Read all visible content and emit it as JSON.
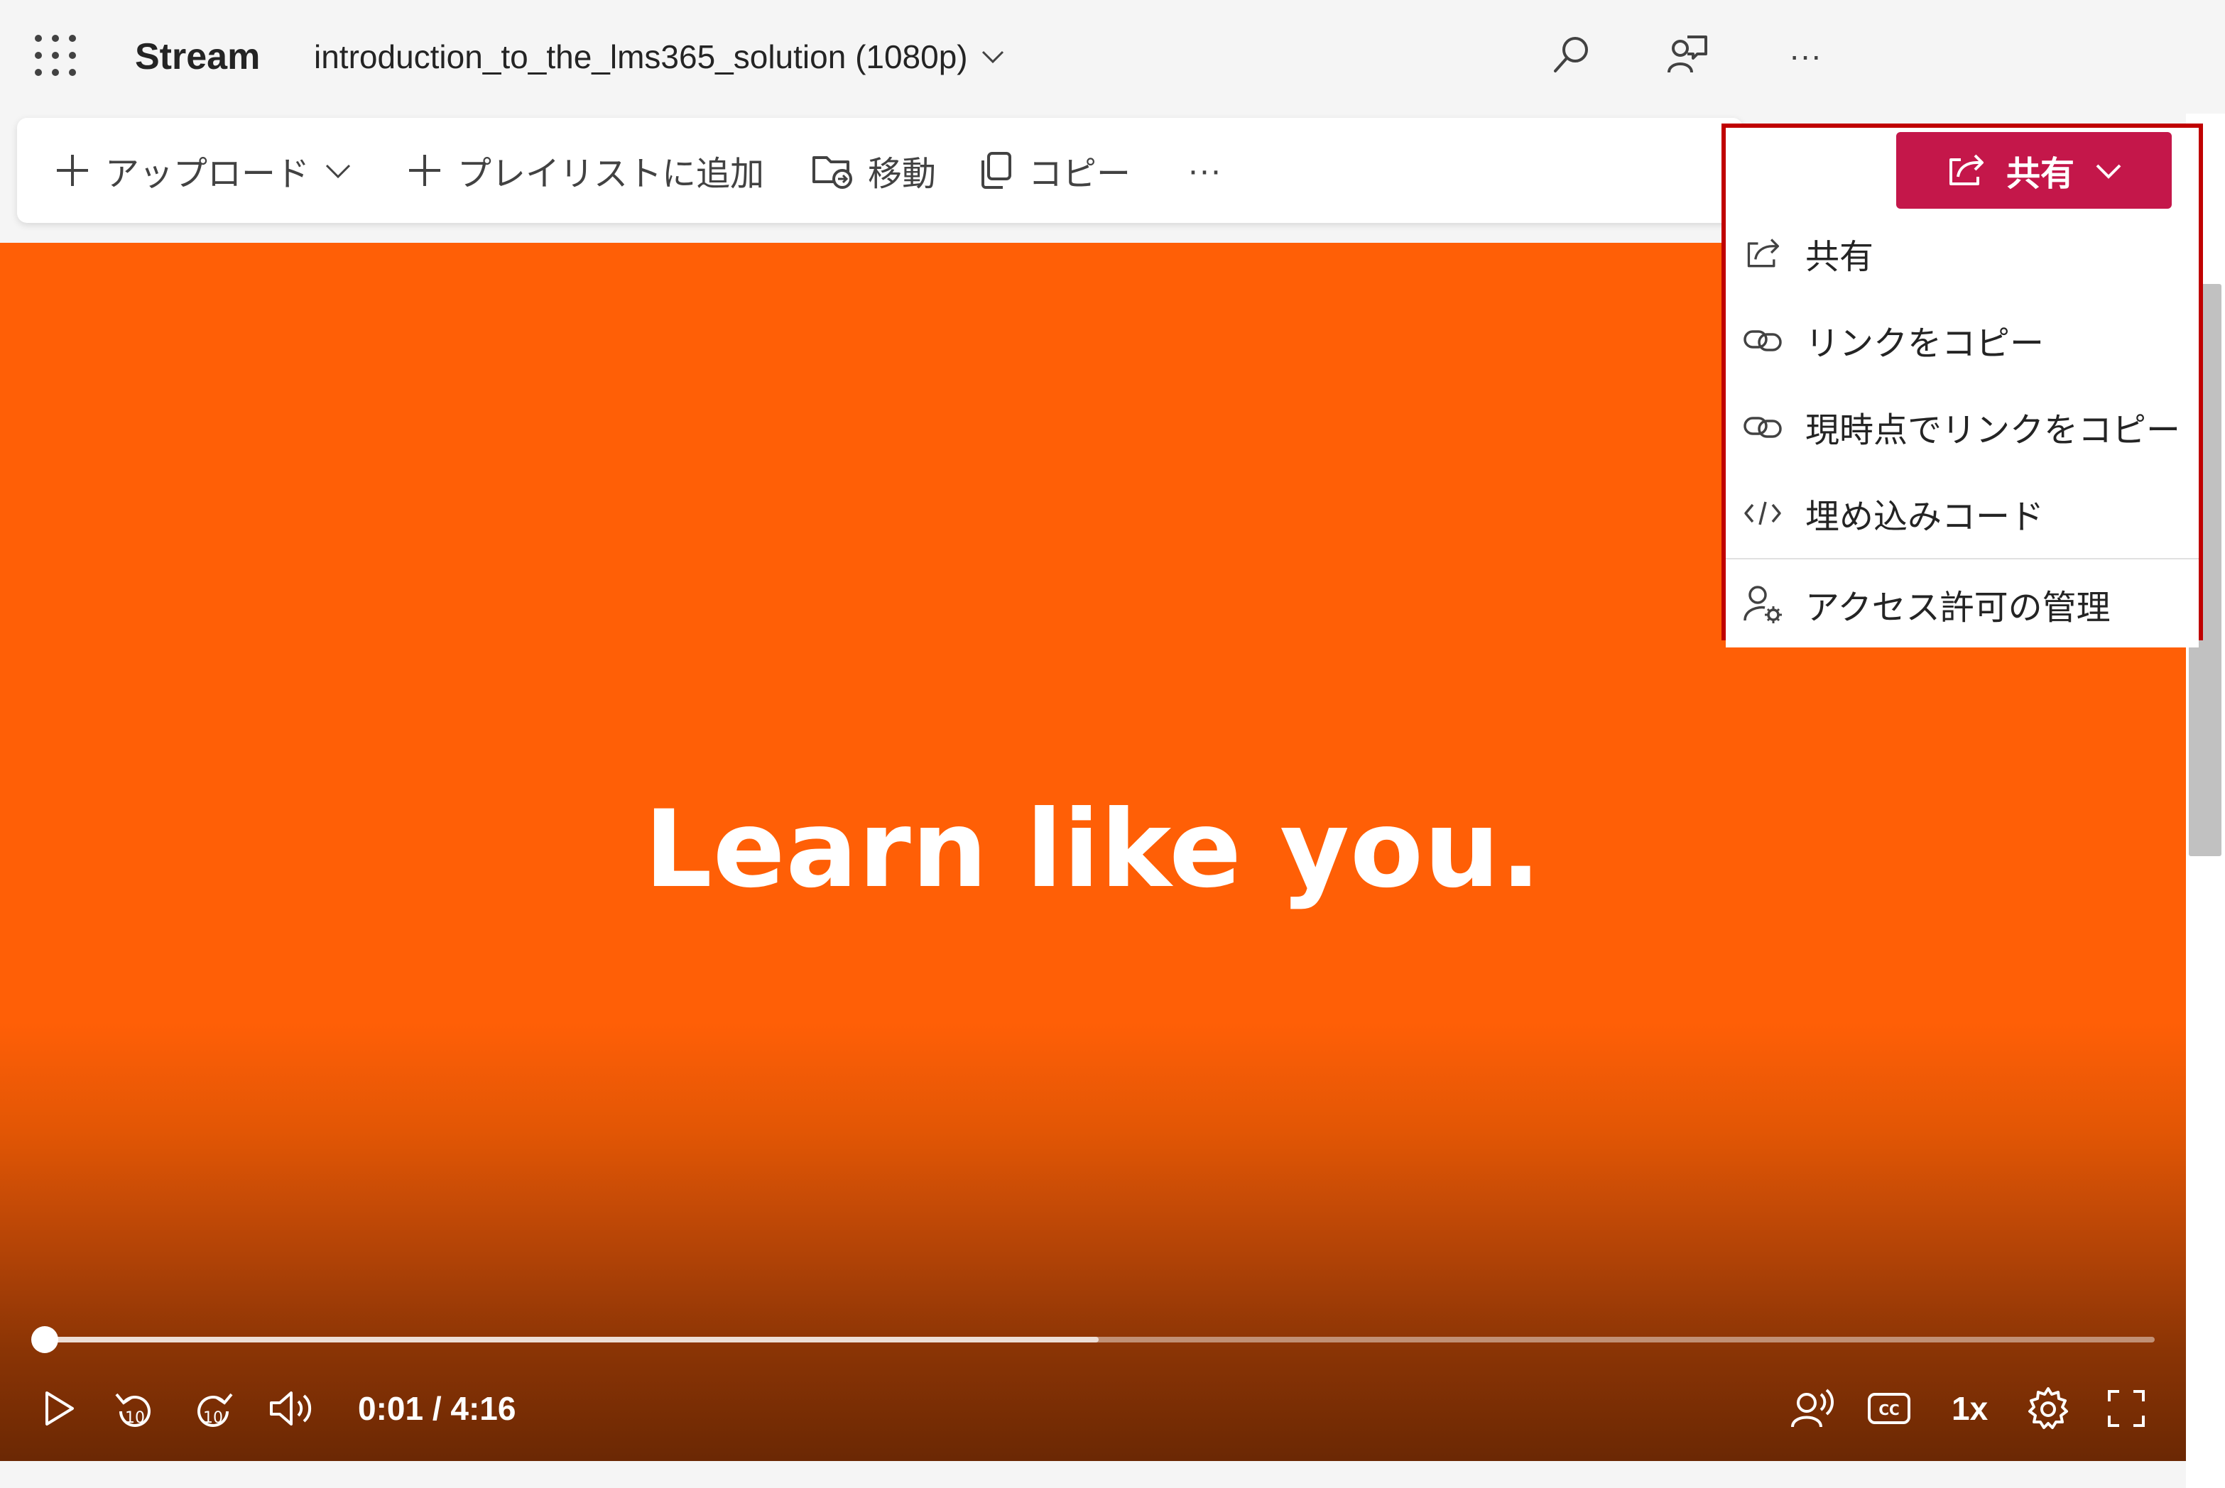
{
  "app": {
    "name": "Stream"
  },
  "file": {
    "title": "introduction_to_the_lms365_solution (1080p)"
  },
  "commands": {
    "upload": "アップロード",
    "add_to_playlist": "プレイリストに追加",
    "move": "移動",
    "copy": "コピー",
    "more": "···"
  },
  "top_more": "···",
  "share": {
    "button_label": "共有",
    "menu": [
      {
        "label": "共有",
        "icon": "share-icon"
      },
      {
        "label": "リンクをコピー",
        "icon": "link-icon"
      },
      {
        "label": "現時点でリンクをコピー",
        "icon": "link-icon"
      },
      {
        "label": "埋め込みコード",
        "icon": "code-icon"
      },
      {
        "label": "アクセス許可の管理",
        "icon": "person-gear-icon"
      }
    ]
  },
  "video": {
    "slogan": "Learn like you.",
    "time": "0:01 / 4:16",
    "speed": "1x",
    "buffered_fraction": 0.5,
    "played_fraction": 0.004
  },
  "colors": {
    "accent": "#c4174a",
    "highlight_border": "#c00000",
    "video_background": "#ff5f06"
  }
}
